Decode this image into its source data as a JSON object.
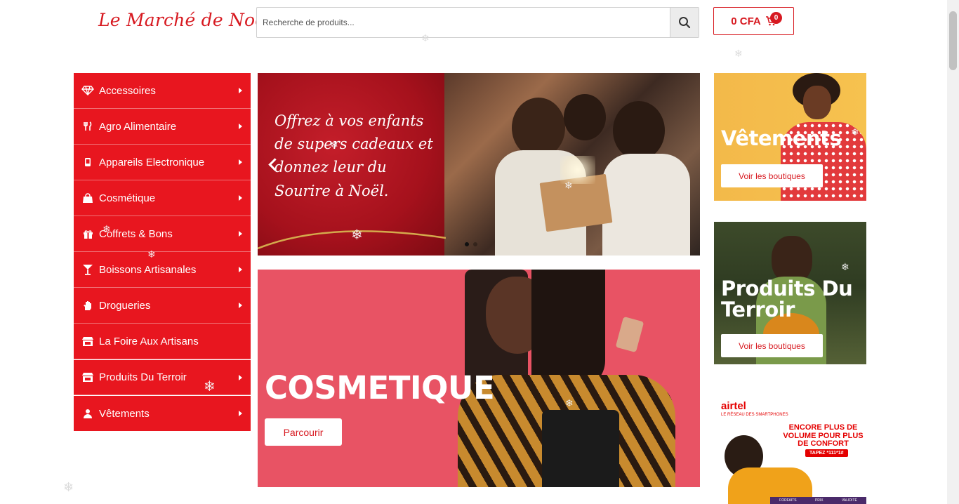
{
  "header": {
    "logo": "Le Marché de Noël",
    "search_placeholder": "Recherche de produits...",
    "search_icon": "search-icon",
    "cart_total": "0 CFA",
    "cart_count": "0",
    "cart_icon": "cart-icon"
  },
  "sidebar": {
    "items": [
      {
        "label": "Accessoires",
        "icon": "diamond-icon"
      },
      {
        "label": "Agro Alimentaire",
        "icon": "utensils-icon"
      },
      {
        "label": "Appareils Electronique",
        "icon": "mobile-icon"
      },
      {
        "label": "Cosmétique",
        "icon": "bag-icon"
      },
      {
        "label": "Coffrets & Bons",
        "icon": "gift-icon"
      },
      {
        "label": "Boissons Artisanales",
        "icon": "cocktail-icon"
      },
      {
        "label": "Drogueries",
        "icon": "hand-icon"
      },
      {
        "label": "La Foire Aux Artisans",
        "icon": "store-icon"
      },
      {
        "label": "Produits Du Terroir",
        "icon": "store-icon"
      },
      {
        "label": "Vêtements",
        "icon": "user-icon"
      }
    ]
  },
  "hero": {
    "text": "Offrez à vos enfants de supers cadeaux et donnez leur du Sourire à Noël."
  },
  "cosmetic_banner": {
    "title": "COSMETIQUE",
    "button": "Parcourir"
  },
  "promos": [
    {
      "title": "Vêtements",
      "button": "Voir les boutiques"
    },
    {
      "title": "Produits Du Terroir",
      "button": "Voir les boutiques"
    }
  ],
  "airtel_ad": {
    "logo": "airtel",
    "tagline": "LE RÉSEAU DES SMARTPHONES",
    "headline": "ENCORE PLUS DE VOLUME POUR PLUS DE CONFORT",
    "code": "TAPEZ *111*1#",
    "footer": [
      "FORFAITS",
      "PRIX",
      "VALIDITÉ"
    ]
  },
  "colors": {
    "brand_red": "#e8161f",
    "cosmetic_pink": "#e85364",
    "promo_yellow": "#f3b94a"
  }
}
